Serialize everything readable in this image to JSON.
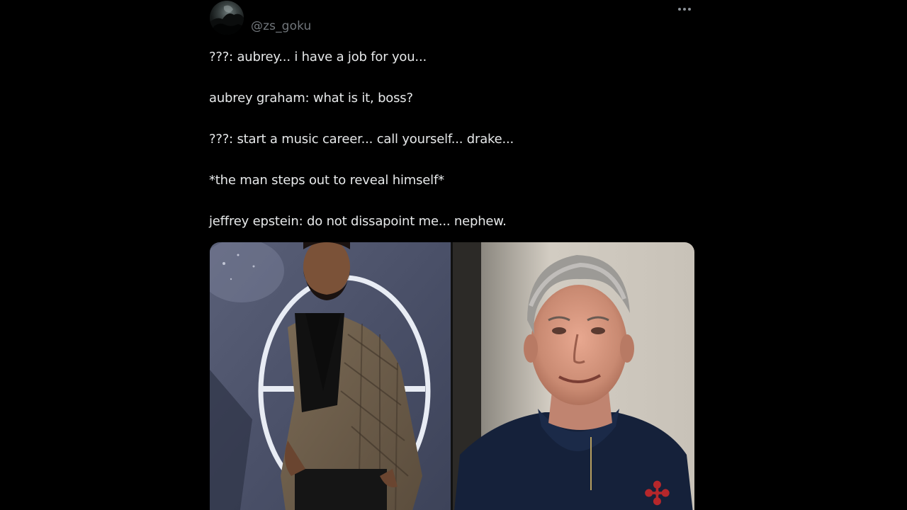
{
  "tweet": {
    "handle": "@zs_goku",
    "lines": [
      "???: aubrey... i have a job for you...",
      "aubrey graham: what is it, boss?",
      "???: start a music career... call yourself... drake...",
      "*the man steps out to reveal himself*",
      "jeffrey epstein: do not dissapoint me... nephew."
    ],
    "media": {
      "count": 2
    }
  },
  "colors": {
    "background": "#000000",
    "text": "#e7e9ea",
    "secondary_text": "#71767b"
  },
  "icons": {
    "more": "more-horizontal-icon"
  }
}
